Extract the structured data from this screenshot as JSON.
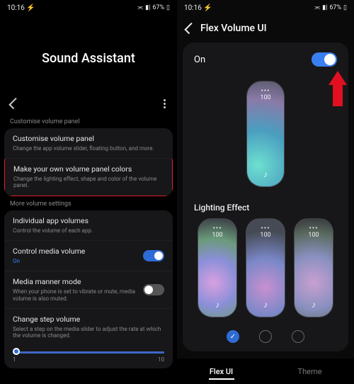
{
  "status": {
    "time": "10:16",
    "indicators": "⚡",
    "right_text": "67%",
    "wifi": "⫘",
    "signal": "▮|",
    "battery": "▯"
  },
  "left": {
    "title": "Sound Assistant",
    "section1_label": "Customise volume panel",
    "row_customise": {
      "title": "Customise volume panel",
      "sub": "Change the app volume slider, floating button, and more."
    },
    "row_colors": {
      "title": "Make your own volume panel colors",
      "sub": "Change the lighting effect, shape and color of the volume panel."
    },
    "section2_label": "More volume settings",
    "row_individual": {
      "title": "Individual app volumes",
      "sub": "Control the volume of each app."
    },
    "row_control_media": {
      "title": "Control media volume",
      "sub": "On"
    },
    "row_manner": {
      "title": "Media manner mode",
      "sub": "When your phone is set to vibrate or mute, media volume is also muted."
    },
    "row_step": {
      "title": "Change step volume",
      "sub": "Select a step on the media slider to adjust the rate at which the volume is changed."
    },
    "slider": {
      "min": "1",
      "max": "10"
    }
  },
  "right": {
    "header_title": "Flex Volume UI",
    "on_label": "On",
    "vol_value": "100",
    "section_lighting": "Lighting Effect",
    "tabs": {
      "flex": "Flex UI",
      "theme": "Theme"
    }
  }
}
